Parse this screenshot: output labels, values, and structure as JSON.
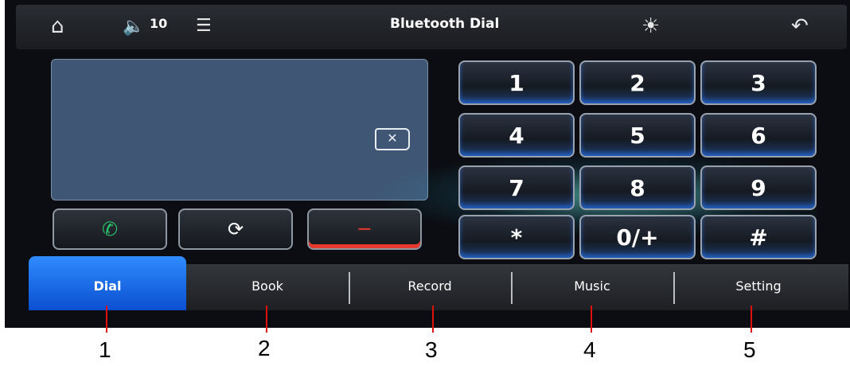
{
  "header": {
    "home_icon": "home-icon",
    "volume_text": "10",
    "eq_icon": "equalizer-icon",
    "title": "Bluetooth Dial",
    "brightness_icon": "brightness-icon",
    "back_icon": "back-icon"
  },
  "display": {
    "number": "",
    "backspace_icon": "backspace-icon"
  },
  "keypad": [
    "1",
    "2",
    "3",
    "4",
    "5",
    "6",
    "7",
    "8",
    "9",
    "*",
    "0/+",
    "#"
  ],
  "call_controls": {
    "answer_icon": "phone-icon",
    "audio_transfer_icon": "audio-transfer-icon",
    "hangup_icon": "hangup-icon"
  },
  "tabs": [
    "Dial",
    "Book",
    "Record",
    "Music",
    "Setting"
  ],
  "active_tab": "Dial",
  "callouts": [
    "1",
    "2",
    "3",
    "4",
    "5"
  ],
  "colors": {
    "active_tab": "#1f6ff0",
    "answer": "#29c46b",
    "hangup": "#e63a2e",
    "callout_line": "#e01010"
  }
}
